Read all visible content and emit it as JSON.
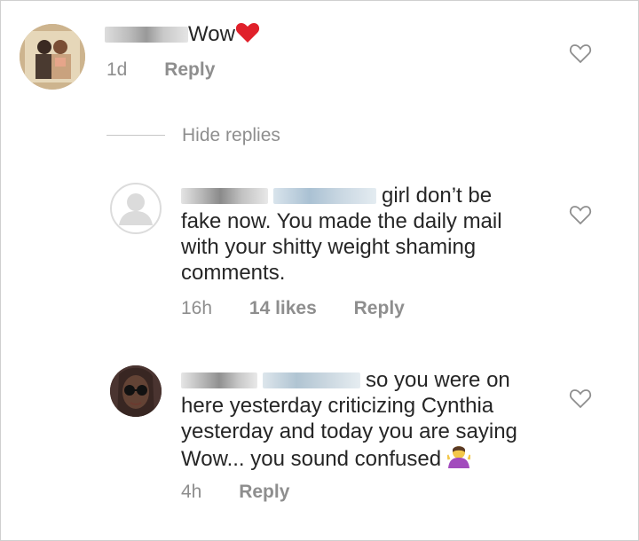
{
  "comments": [
    {
      "text": "Wow",
      "time": "1d",
      "reply_label": "Reply",
      "avatar_icon": "profile-photo-couple"
    },
    {
      "text_line1": "girl don’t be",
      "text_rest": "fake now. You made the daily mail with your shitty weight shaming comments.",
      "time": "16h",
      "likes": "14 likes",
      "reply_label": "Reply",
      "avatar_icon": "default-avatar-icon"
    },
    {
      "text_line1": "so you were on",
      "text_rest": "here yesterday criticizing Cynthia yesterday and today you are saying Wow... you sound confused",
      "time": "4h",
      "reply_label": "Reply",
      "avatar_icon": "profile-photo-woman-sunglasses"
    }
  ],
  "thread": {
    "hide_replies_label": "Hide replies"
  },
  "colors": {
    "text": "#262626",
    "meta": "#8e8e8e",
    "heart_red": "#e0202a"
  }
}
